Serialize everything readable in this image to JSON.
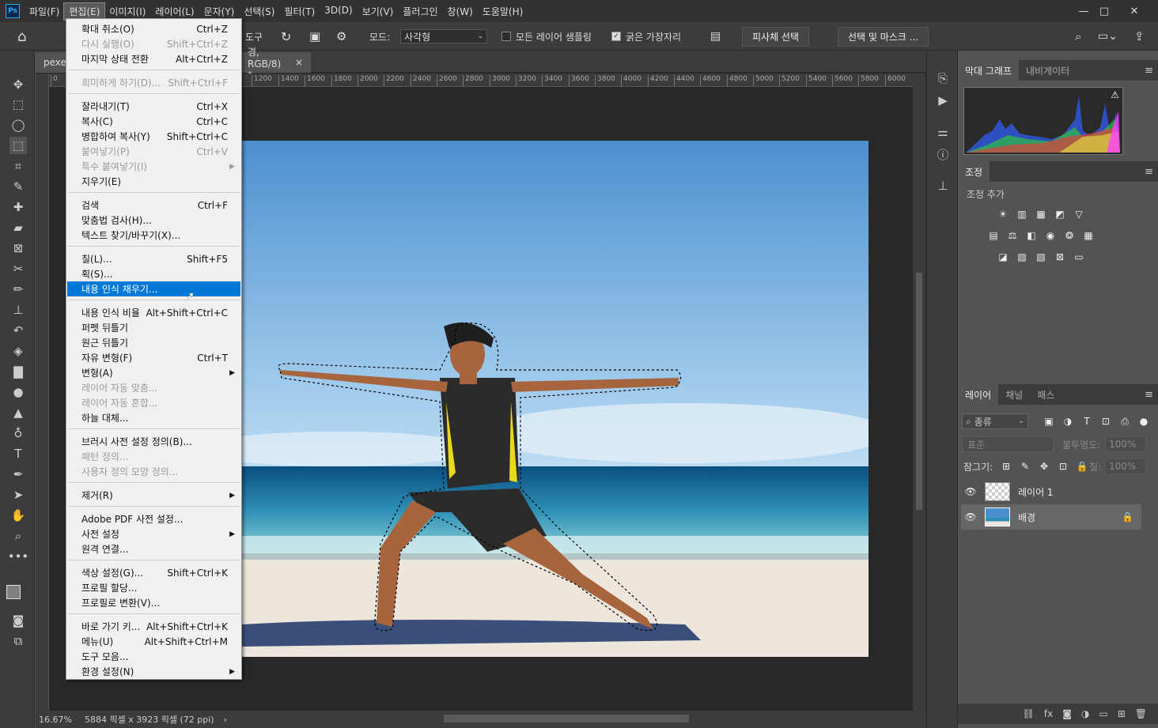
{
  "app": {
    "logo": "Ps"
  },
  "menubar": {
    "items": [
      "파일(F)",
      "편집(E)",
      "이미지(I)",
      "레이어(L)",
      "문자(Y)",
      "선택(S)",
      "필터(T)",
      "3D(D)",
      "보기(V)",
      "플러그인",
      "창(W)",
      "도움말(H)"
    ],
    "active_index": 1
  },
  "window_controls": {
    "minimize": "—",
    "maximize": "□",
    "close": "✕"
  },
  "options": {
    "tool_suffix": "도구",
    "mode_label": "모드:",
    "mode_value": "사각형",
    "sample_all": "모든 레이어 샘플링",
    "hard_edge": "굵은 가장자리",
    "subject_select": "피사체 선택",
    "select_mask": "선택 및 마스크 ..."
  },
  "tabs": {
    "doc1": "pexel",
    "doc2": "경, RGB/8) *",
    "close": "×"
  },
  "ruler": {
    "ticks": [
      "0",
      "1200",
      "1400",
      "1600",
      "1800",
      "2000",
      "2200",
      "2400",
      "2600",
      "2800",
      "3000",
      "3200",
      "3400",
      "3600",
      "3800",
      "4000",
      "4200",
      "4400",
      "4600",
      "4800",
      "5000",
      "5200",
      "5400",
      "5600",
      "5800",
      "6000"
    ]
  },
  "status": {
    "zoom": "16.67%",
    "doc_info": "5884 픽셀 x 3923 픽셀 (72 ppi)",
    "arrow": "›"
  },
  "panels": {
    "histogram_tab": "막대 그래프",
    "navigator_tab": "내비게이터",
    "adjust_tab": "조정",
    "adjust_add": "조정 추가",
    "layers_tab": "레이어",
    "channels_tab": "채널",
    "paths_tab": "패스",
    "kind_label": "종류",
    "blend_mode": "표준",
    "opacity_label": "불투명도:",
    "opacity_value": "100%",
    "lock_label": "잠그기:",
    "fill_label": "칠:",
    "fill_value": "100%"
  },
  "layers": [
    {
      "name": "레이어 1",
      "locked": false
    },
    {
      "name": "배경",
      "locked": true
    }
  ],
  "edit_menu": {
    "items": [
      {
        "label": "확대 취소(O)",
        "shortcut": "Ctrl+Z",
        "disabled": false
      },
      {
        "label": "다시 실행(O)",
        "shortcut": "Shift+Ctrl+Z",
        "disabled": true
      },
      {
        "label": "마지막 상태 전환",
        "shortcut": "Alt+Ctrl+Z",
        "disabled": false
      },
      {
        "label": "희미하게 하기(D)...",
        "shortcut": "Shift+Ctrl+F",
        "disabled": true
      },
      {
        "label": "잘라내기(T)",
        "shortcut": "Ctrl+X",
        "disabled": false
      },
      {
        "label": "복사(C)",
        "shortcut": "Ctrl+C",
        "disabled": false
      },
      {
        "label": "병합하여 복사(Y)",
        "shortcut": "Shift+Ctrl+C",
        "disabled": false
      },
      {
        "label": "붙여넣기(P)",
        "shortcut": "Ctrl+V",
        "disabled": true
      },
      {
        "label": "특수 붙여넣기(I)",
        "shortcut": "",
        "disabled": true,
        "submenu": true
      },
      {
        "label": "지우기(E)",
        "shortcut": "",
        "disabled": false
      },
      {
        "label": "검색",
        "shortcut": "Ctrl+F",
        "disabled": false
      },
      {
        "label": "맞춤법 검사(H)...",
        "shortcut": "",
        "disabled": false
      },
      {
        "label": "텍스트 찾기/바꾸기(X)...",
        "shortcut": "",
        "disabled": false
      },
      {
        "label": "칠(L)...",
        "shortcut": "Shift+F5",
        "disabled": false
      },
      {
        "label": "획(S)...",
        "shortcut": "",
        "disabled": false
      },
      {
        "label": "내용 인식 채우기...",
        "shortcut": "",
        "disabled": false,
        "highlighted": true
      },
      {
        "label": "내용 인식 비율",
        "shortcut": "Alt+Shift+Ctrl+C",
        "disabled": false
      },
      {
        "label": "퍼펫 뒤틀기",
        "shortcut": "",
        "disabled": false
      },
      {
        "label": "원근 뒤틀기",
        "shortcut": "",
        "disabled": false
      },
      {
        "label": "자유 변형(F)",
        "shortcut": "Ctrl+T",
        "disabled": false
      },
      {
        "label": "변형(A)",
        "shortcut": "",
        "disabled": false,
        "submenu": true
      },
      {
        "label": "레이어 자동 맞춤...",
        "shortcut": "",
        "disabled": true
      },
      {
        "label": "레이어 자동 혼합...",
        "shortcut": "",
        "disabled": true
      },
      {
        "label": "하늘 대체...",
        "shortcut": "",
        "disabled": false
      },
      {
        "label": "브러시 사전 설정 정의(B)...",
        "shortcut": "",
        "disabled": false
      },
      {
        "label": "패턴 정의...",
        "shortcut": "",
        "disabled": true
      },
      {
        "label": "사용자 정의 모양 정의...",
        "shortcut": "",
        "disabled": true
      },
      {
        "label": "제거(R)",
        "shortcut": "",
        "disabled": false,
        "submenu": true
      },
      {
        "label": "Adobe PDF 사전 설정...",
        "shortcut": "",
        "disabled": false
      },
      {
        "label": "사전 설정",
        "shortcut": "",
        "disabled": false,
        "submenu": true
      },
      {
        "label": "원격 연결...",
        "shortcut": "",
        "disabled": false
      },
      {
        "label": "색상 설정(G)...",
        "shortcut": "Shift+Ctrl+K",
        "disabled": false
      },
      {
        "label": "프로필 할당...",
        "shortcut": "",
        "disabled": false
      },
      {
        "label": "프로필로 변환(V)...",
        "shortcut": "",
        "disabled": false
      },
      {
        "label": "바로 가기 키...",
        "shortcut": "Alt+Shift+Ctrl+K",
        "disabled": false
      },
      {
        "label": "메뉴(U)",
        "shortcut": "Alt+Shift+Ctrl+M",
        "disabled": false
      },
      {
        "label": "도구 모음...",
        "shortcut": "",
        "disabled": false
      },
      {
        "label": "환경 설정(N)",
        "shortcut": "",
        "disabled": false,
        "submenu": true
      }
    ]
  },
  "colors": {
    "accent": "#0078d7",
    "bg": "#535353",
    "panel": "#3c3c3c"
  }
}
